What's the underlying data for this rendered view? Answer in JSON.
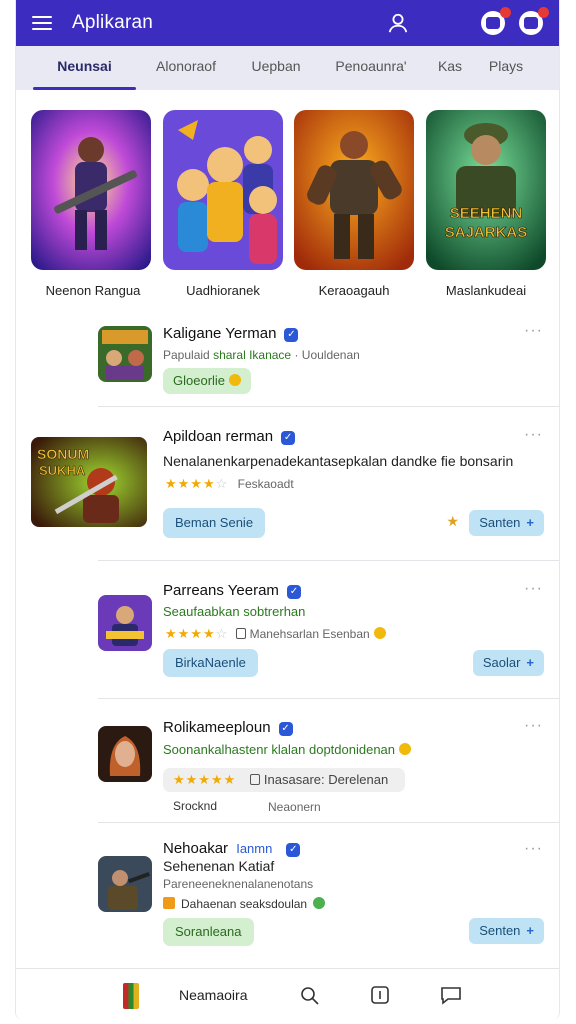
{
  "header": {
    "title": "Aplikaran"
  },
  "tabs": [
    "Neunsai",
    "Alonoraof",
    "Uepban",
    "Penoaunra'",
    "Kas",
    "Plays"
  ],
  "featured": [
    {
      "label": "Neenon Rangua"
    },
    {
      "label": "Uadhioranek"
    },
    {
      "label": "Keraoagauh"
    },
    {
      "label": "Maslankudeai"
    }
  ],
  "featured_banner_text": [
    "SEEHENN",
    "SAJARKAS"
  ],
  "list": [
    {
      "title": "Kaligane Yerman",
      "subtitle": "Papulaid",
      "subtitle_green": "sharal Ikanace",
      "subtitle_tail": "· Uouldenan",
      "pill": "Gloeorlie"
    },
    {
      "title": "Apildoan rerman",
      "description": "Nenalanenkarpenadekantasepkalan dandke fie bonsarin",
      "rating_text": "Feskaoadt",
      "thumb_text": [
        "SONUM",
        "SUKHA"
      ],
      "pill": "Beman Senie",
      "action": "Santen"
    },
    {
      "title": "Parreans Yeeram",
      "subtitle": "Seaufaabkan sobtrerhan",
      "rating_text": "Manehsarlan Esenban",
      "pill": "BirkaNaenle",
      "action": "Saolar"
    },
    {
      "title": "Rolikameeploun",
      "subtitle": "Soonankalhastenr klalan doptdonidenan",
      "tag": "Inasasare: Derelenan",
      "meta_left": "Srocknd",
      "meta_right": "Neaonern"
    },
    {
      "title": "Nehoakar",
      "title_blue": "Ianmn",
      "title_line2": "Sehenenan Katiaf",
      "subtitle": "Pareneeneknenalanenotans",
      "note": "Dahaenan seaksdoulan",
      "pill": "Soranleana",
      "action": "Senten"
    }
  ],
  "bottom_nav": {
    "label": "Neamaoira"
  },
  "colors": {
    "brand": "#3c2cc0",
    "verified": "#2b58d6",
    "star": "#f2a900"
  }
}
